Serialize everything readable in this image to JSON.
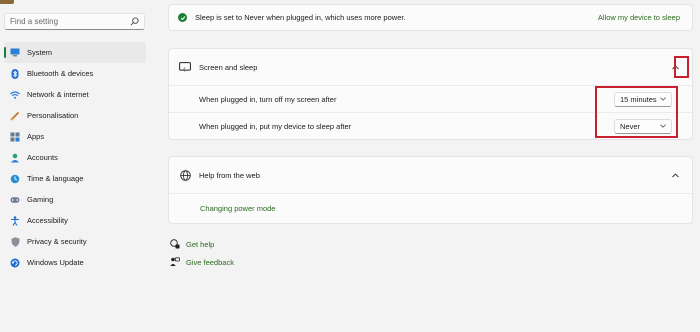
{
  "search": {
    "placeholder": "Find a setting"
  },
  "sidebar": {
    "items": [
      {
        "label": "System",
        "icon": "monitor-icon",
        "active": true
      },
      {
        "label": "Bluetooth & devices",
        "icon": "bluetooth-icon"
      },
      {
        "label": "Network & internet",
        "icon": "wifi-icon"
      },
      {
        "label": "Personalisation",
        "icon": "brush-icon"
      },
      {
        "label": "Apps",
        "icon": "apps-icon"
      },
      {
        "label": "Accounts",
        "icon": "person-icon"
      },
      {
        "label": "Time & language",
        "icon": "globe-clock-icon"
      },
      {
        "label": "Gaming",
        "icon": "gamepad-icon"
      },
      {
        "label": "Accessibility",
        "icon": "accessibility-icon"
      },
      {
        "label": "Privacy & security",
        "icon": "shield-icon"
      },
      {
        "label": "Windows Update",
        "icon": "update-icon"
      }
    ]
  },
  "banner": {
    "message": "Sleep is set to Never when plugged in, which uses more power.",
    "action": "Allow my device to sleep"
  },
  "screen_sleep": {
    "title": "Screen and sleep",
    "rows": [
      {
        "label": "When plugged in, turn off my screen after",
        "value": "15 minutes"
      },
      {
        "label": "When plugged in, put my device to sleep after",
        "value": "Never"
      }
    ]
  },
  "help": {
    "title": "Help from the web",
    "link": "Changing power mode"
  },
  "footer": {
    "get_help": "Get help",
    "give_feedback": "Give feedback"
  },
  "colors": {
    "accent": "#1a7f37",
    "link": "#2a6b1e",
    "highlight": "#c8202f"
  }
}
